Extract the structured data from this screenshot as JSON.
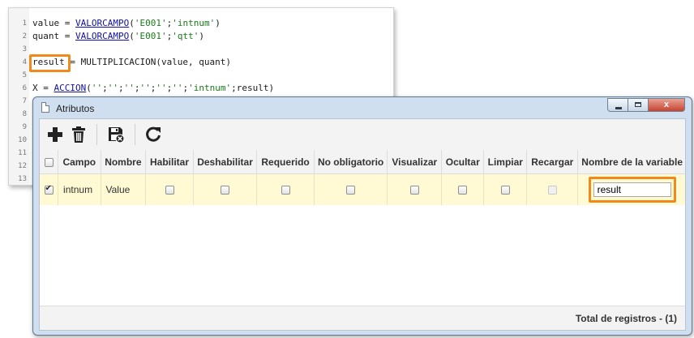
{
  "editor": {
    "lines": [
      {
        "num": "1",
        "parts": [
          {
            "t": "value = ",
            "c": "kw"
          },
          {
            "t": "VALORCAMPO",
            "c": "fn-link"
          },
          {
            "t": "(",
            "c": "kw"
          },
          {
            "t": "'E001'",
            "c": "str"
          },
          {
            "t": ";",
            "c": "kw"
          },
          {
            "t": "'intnum'",
            "c": "str"
          },
          {
            "t": ")",
            "c": "kw"
          }
        ]
      },
      {
        "num": "2",
        "parts": [
          {
            "t": "quant = ",
            "c": "kw"
          },
          {
            "t": "VALORCAMPO",
            "c": "fn-link"
          },
          {
            "t": "(",
            "c": "kw"
          },
          {
            "t": "'E001'",
            "c": "str"
          },
          {
            "t": ";",
            "c": "kw"
          },
          {
            "t": "'qtt'",
            "c": "str"
          },
          {
            "t": ")",
            "c": "kw"
          }
        ]
      },
      {
        "num": "3",
        "parts": []
      },
      {
        "num": "4",
        "parts": [
          {
            "t": "result = MULTIPLICACION(value, quant)",
            "c": "kw"
          }
        ]
      },
      {
        "num": "5",
        "parts": []
      },
      {
        "num": "6",
        "parts": [
          {
            "t": "X = ",
            "c": "kw"
          },
          {
            "t": "ACCION",
            "c": "fn-link"
          },
          {
            "t": "(",
            "c": "kw"
          },
          {
            "t": "''",
            "c": "str"
          },
          {
            "t": ";",
            "c": "kw"
          },
          {
            "t": "''",
            "c": "str"
          },
          {
            "t": ";",
            "c": "kw"
          },
          {
            "t": "''",
            "c": "str"
          },
          {
            "t": ";",
            "c": "kw"
          },
          {
            "t": "''",
            "c": "str"
          },
          {
            "t": ";",
            "c": "kw"
          },
          {
            "t": "''",
            "c": "str"
          },
          {
            "t": ";",
            "c": "kw"
          },
          {
            "t": "''",
            "c": "str"
          },
          {
            "t": ";",
            "c": "kw"
          },
          {
            "t": "'intnum'",
            "c": "str"
          },
          {
            "t": ";result)",
            "c": "kw"
          }
        ]
      },
      {
        "num": "7",
        "parts": []
      },
      {
        "num": "8",
        "parts": []
      },
      {
        "num": "9",
        "parts": []
      },
      {
        "num": "10",
        "parts": []
      },
      {
        "num": "11",
        "parts": []
      },
      {
        "num": "12",
        "parts": []
      },
      {
        "num": "13",
        "parts": []
      }
    ]
  },
  "window": {
    "title": "Atributos",
    "close_glyph": "x"
  },
  "table": {
    "headers": [
      "Campo",
      "Nombre",
      "Habilitar",
      "Deshabilitar",
      "Requerido",
      "No obligatorio",
      "Visualizar",
      "Ocultar",
      "Limpiar",
      "Recargar",
      "Nombre de la variable"
    ],
    "row": {
      "campo": "intnum",
      "nombre": "Value",
      "variable": "result"
    }
  },
  "footer": {
    "total_label": "Total de registros  - (1)"
  },
  "colors": {
    "highlight": "#f08a1c",
    "row_selected": "#fffad3",
    "link": "#1010a0",
    "string": "#1a7a1a"
  }
}
